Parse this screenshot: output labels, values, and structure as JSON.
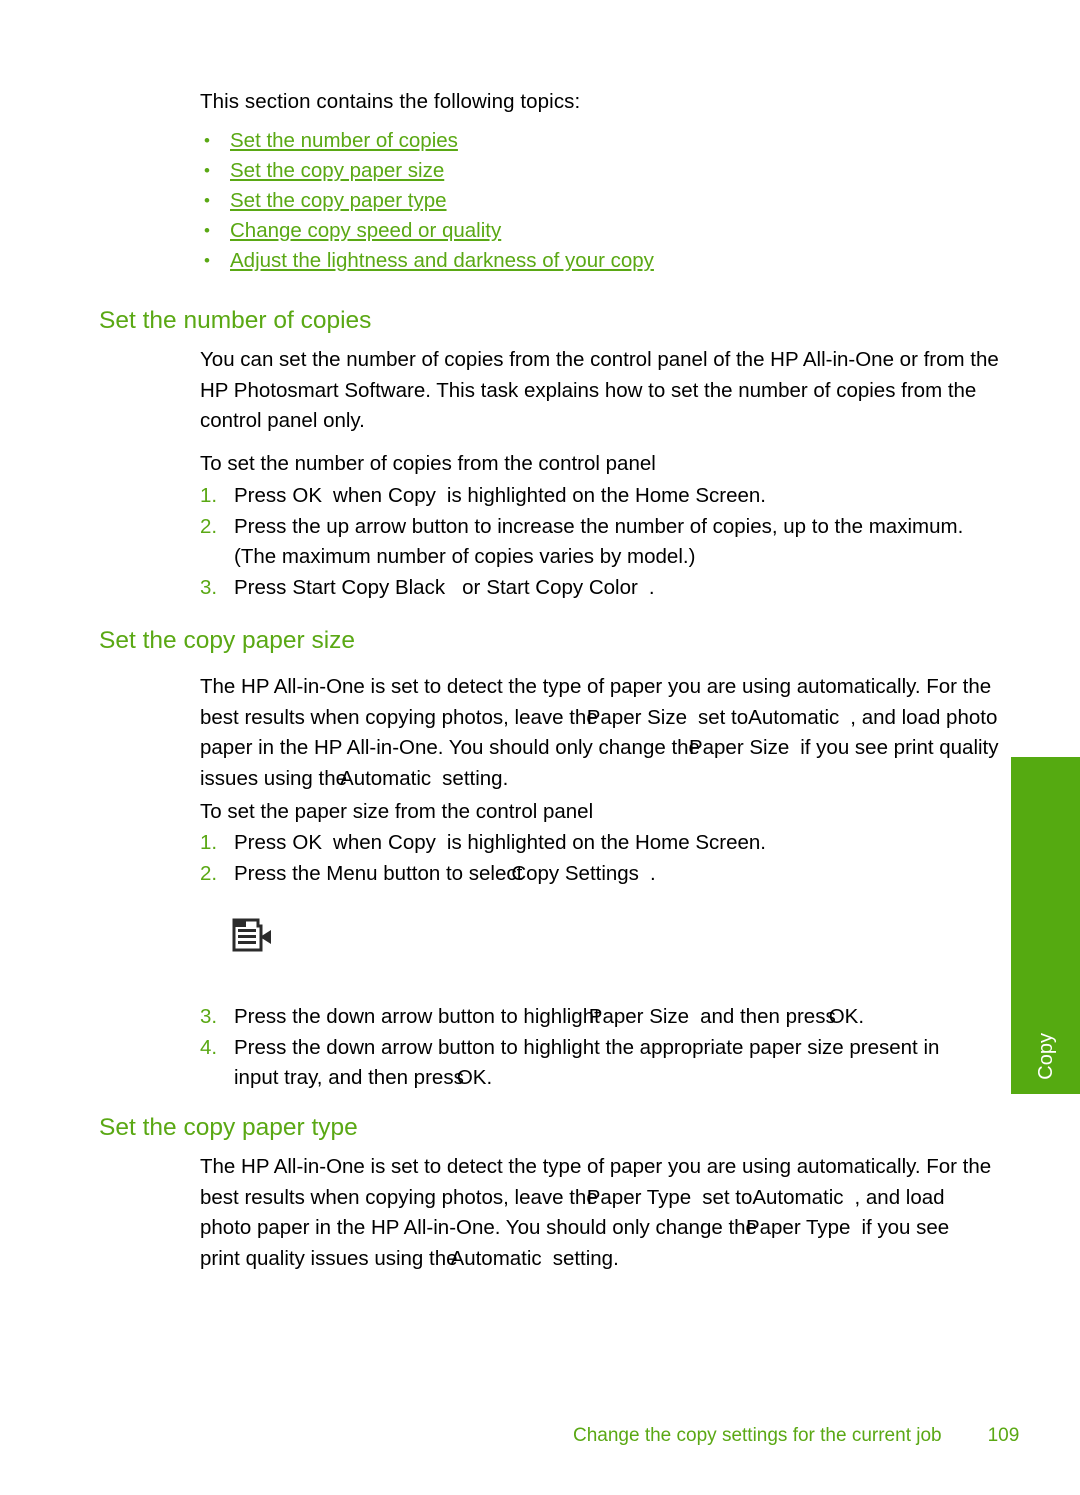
{
  "intro": {
    "text": "This section contains the following topics:"
  },
  "topics": {
    "bullet_glyph": "•",
    "items": [
      {
        "label": "Set the number of copies"
      },
      {
        "label": "Set the copy paper size"
      },
      {
        "label": "Set the copy paper type"
      },
      {
        "label": "Change copy speed or quality"
      },
      {
        "label": "Adjust the lightness and darkness of your copy"
      }
    ]
  },
  "sections": {
    "copies": {
      "heading": "Set the number of copies",
      "paragraph": {
        "line1": "You can set the number of copies from the control panel of the HP All-in-One or from the",
        "line2": "HP Photosmart Software. This task explains how to set the number of copies from the",
        "line3": "control panel only."
      },
      "procedure_title": "To set the number of copies from the control panel",
      "steps": [
        {
          "num": "1.",
          "seg1": "Press",
          "term1": "OK",
          "seg2": "when",
          "term2": "Copy",
          "seg3": "is highlighted on the Home Screen."
        },
        {
          "num": "2.",
          "line1": "Press the up arrow button to increase the number of copies, up to the maximum.",
          "line2": "(The maximum number of copies varies by model.)"
        },
        {
          "num": "3.",
          "seg1": "Press",
          "term1": "Start Copy Black",
          "seg2": "or",
          "term2": "Start Copy Color",
          "seg3": "."
        }
      ]
    },
    "paper_size": {
      "heading": "Set the copy paper size",
      "paragraph": {
        "line1a": "The HP All-in-One is set to detect the type of paper you are using automatically. For the",
        "line2a": "best results when copying photos, leave the",
        "line2b": "Paper Size",
        "line2c": "set to",
        "line2d": "Automatic",
        "line2e": ", and load photo",
        "line3a": "paper in the HP All-in-One. You should only change the",
        "line3b": "Paper Size",
        "line3c": "if you see print quality",
        "line4a": "issues using the",
        "line4b": "Automatic",
        "line4c": "setting."
      },
      "procedure_title": "To set the paper size from the control panel",
      "steps_before_note": [
        {
          "num": "1.",
          "seg1": "Press",
          "term1": "OK",
          "seg2": "when",
          "term2": "Copy",
          "seg3": "is highlighted on the Home Screen."
        },
        {
          "num": "2.",
          "seg1": "Press the Menu button to select",
          "term1": "Copy Settings",
          "seg2": "."
        }
      ],
      "note_icon": "document-note-icon",
      "steps_after_note": [
        {
          "num": "3.",
          "seg1": "Press the down arrow button to highlight",
          "term1": "Paper Size",
          "seg2": "and then press",
          "term2": "OK",
          "seg3": "."
        },
        {
          "num": "4.",
          "line1": "Press the down arrow button to highlight the appropriate paper size present in",
          "line2a": "input tray, and then press",
          "line2b": "OK",
          "line2c": "."
        }
      ]
    },
    "paper_type": {
      "heading": "Set the copy paper type",
      "paragraph": {
        "line1a": "The HP All-in-One is set to detect the type of paper you are using automatically. For the",
        "line2a": "best results when copying photos, leave the",
        "line2b": "Paper Type",
        "line2c": "set to",
        "line2d": "Automatic",
        "line2e": ", and load",
        "line3a": "photo paper in the HP All-in-One. You should only change the",
        "line3b": "Paper Type",
        "line3c": "if you see",
        "line4a": "print quality issues using the",
        "line4b": "Automatic",
        "line4c": "setting."
      }
    }
  },
  "side_tab": {
    "label": "Copy",
    "color": "#55aa11"
  },
  "footer": {
    "text": "Change the copy settings for the current job",
    "page_number": "109",
    "color": "#5aa814"
  }
}
